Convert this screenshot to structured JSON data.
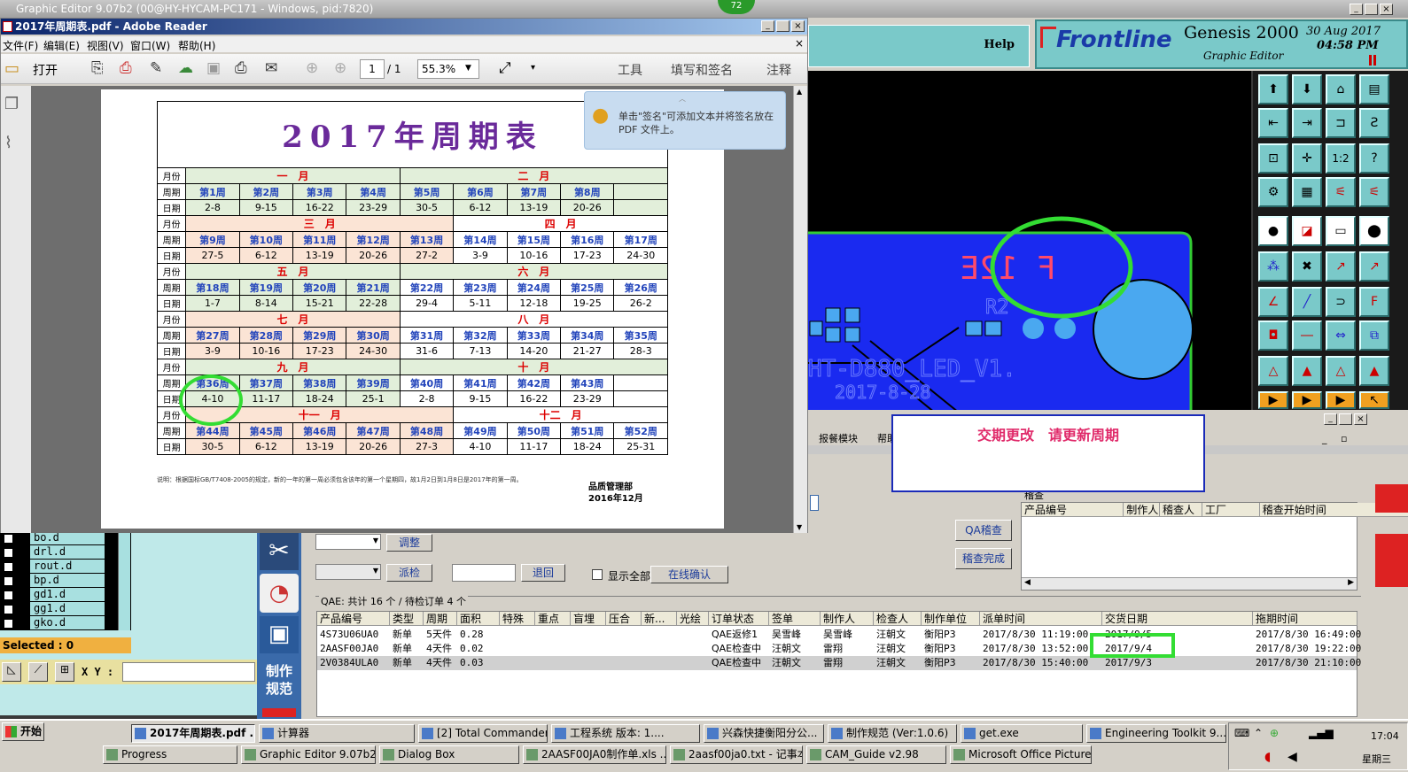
{
  "genesis": {
    "window_title": "Graphic Editor 9.07b2 (00@HY-HYCAM-PC171 - Windows, pid:7820)",
    "help_label": "Help",
    "brand": "Frontline",
    "product": "Genesis 2000",
    "subtitle": "Graphic Editor",
    "date": "30 Aug 2017",
    "time": "04:58 PM",
    "badge": "72",
    "selected": "Selected : 0",
    "xy_label": "X Y :",
    "layers": [
      "bo.d",
      "drl.d",
      "rout.d",
      "bp.d",
      "gd1.d",
      "gg1.d",
      "gko.d"
    ],
    "pcb_texts": {
      "mark": "F 12E",
      "r2": "R2",
      "part": "HT-D880_LED_V1.",
      "date": "2017-8-28"
    }
  },
  "pdf": {
    "title": "2017年周期表.pdf - Adobe Reader",
    "menu": [
      "文件(F)",
      "编辑(E)",
      "视图(V)",
      "窗口(W)",
      "帮助(H)"
    ],
    "open_label": "打开",
    "page_current": "1",
    "page_total": "/ 1",
    "zoom": "55.3%",
    "right_tools": [
      "工具",
      "填写和签名",
      "注释"
    ],
    "tip": "单击\"签名\"可添加文本并将签名放在 PDF 文件上。",
    "calendar_title": "2017年周期表",
    "label_month": "月份",
    "label_week": "周期",
    "label_date": "日期",
    "rows": [
      {
        "months": [
          "一　月",
          "二　月"
        ],
        "split": 4,
        "weeks": [
          "第1周",
          "第2周",
          "第3周",
          "第4周",
          "第5周",
          "第6周",
          "第7周",
          "第8周",
          ""
        ],
        "dates": [
          "2-8",
          "9-15",
          "16-22",
          "23-29",
          "30-5",
          "6-12",
          "13-19",
          "20-26",
          ""
        ]
      },
      {
        "months": [
          "三　月",
          "四　月"
        ],
        "split": 5,
        "weeks": [
          "第9周",
          "第10周",
          "第11周",
          "第12周",
          "第13周",
          "第14周",
          "第15周",
          "第16周",
          "第17周"
        ],
        "dates": [
          "27-5",
          "6-12",
          "13-19",
          "20-26",
          "27-2",
          "3-9",
          "10-16",
          "17-23",
          "24-30"
        ]
      },
      {
        "months": [
          "五　月",
          "六　月"
        ],
        "split": 4,
        "weeks": [
          "第18周",
          "第19周",
          "第20周",
          "第21周",
          "第22周",
          "第23周",
          "第24周",
          "第25周",
          "第26周"
        ],
        "dates": [
          "1-7",
          "8-14",
          "15-21",
          "22-28",
          "29-4",
          "5-11",
          "12-18",
          "19-25",
          "26-2"
        ]
      },
      {
        "months": [
          "七　月",
          "八　月"
        ],
        "split": 4,
        "weeks": [
          "第27周",
          "第28周",
          "第29周",
          "第30周",
          "第31周",
          "第32周",
          "第33周",
          "第34周",
          "第35周"
        ],
        "dates": [
          "3-9",
          "10-16",
          "17-23",
          "24-30",
          "31-6",
          "7-13",
          "14-20",
          "21-27",
          "28-3"
        ]
      },
      {
        "months": [
          "九　月",
          "十　月"
        ],
        "split": 4,
        "weeks": [
          "第36周",
          "第37周",
          "第38周",
          "第39周",
          "第40周",
          "第41周",
          "第42周",
          "第43周",
          ""
        ],
        "dates": [
          "4-10",
          "11-17",
          "18-24",
          "25-1",
          "2-8",
          "9-15",
          "16-22",
          "23-29",
          ""
        ]
      },
      {
        "months": [
          "十一　月",
          "十二　月"
        ],
        "split": 5,
        "weeks": [
          "第44周",
          "第45周",
          "第46周",
          "第47周",
          "第48周",
          "第49周",
          "第50周",
          "第51周",
          "第52周"
        ],
        "dates": [
          "30-5",
          "6-12",
          "13-19",
          "20-26",
          "27-3",
          "4-10",
          "11-17",
          "18-24",
          "25-31"
        ]
      }
    ],
    "note": "说明：根据国标GB/T7408-2005的规定，新的一年的第一周必须包含该年的第一个星期四，故1月2日到1月8日是2017年的第一周。",
    "dept": "品质管理部",
    "doc_date": "2016年12月"
  },
  "dialog": {
    "notice": "交期更改　请更新周期",
    "menu_items": [
      "报餐模块",
      "帮助"
    ],
    "buttons": {
      "adjust": "调整",
      "dispatch": "派检",
      "return": "退回",
      "online_confirm": "在线确认",
      "qa_audit": "QA稽查",
      "audit_done": "稽查完成"
    },
    "show_all": "显示全部",
    "audit_group": "稽查",
    "audit_cols": [
      "产品编号",
      "制作人",
      "稽查人",
      "工厂",
      "稽查开始时间"
    ],
    "qa_summary": "QAE: 共计 16 个 / 待检订单 4 个",
    "side_label": "制作规范",
    "columns": [
      "产品编号",
      "类型",
      "周期",
      "面积",
      "特殊",
      "重点",
      "盲埋",
      "压合",
      "新...",
      "光绘",
      "订单状态",
      "签单",
      "制作人",
      "检查人",
      "制作单位",
      "派单时间",
      "交货日期",
      "拖期时间"
    ],
    "rows": [
      [
        "4S73U06UA0",
        "新单",
        "5天件",
        "0.28",
        "",
        "",
        "",
        "",
        "",
        "",
        "QAE返修1",
        "吴雪峰",
        "吴雪峰",
        "汪朝文",
        "衡阳P3",
        "2017/8/30 11:19:00",
        "2017/9/5",
        "2017/8/30 16:49:00"
      ],
      [
        "2AASF00JA0",
        "新单",
        "4天件",
        "0.02",
        "",
        "",
        "",
        "",
        "",
        "",
        "QAE检查中",
        "汪朝文",
        "雷翔",
        "汪朝文",
        "衡阳P3",
        "2017/8/30 13:52:00",
        "2017/9/4",
        "2017/8/30 19:22:00"
      ],
      [
        "2V0384ULA0",
        "新单",
        "4天件",
        "0.03",
        "",
        "",
        "",
        "",
        "",
        "",
        "QAE检查中",
        "汪朝文",
        "雷翔",
        "汪朝文",
        "衡阳P3",
        "2017/8/30 15:40:00",
        "2017/9/3",
        "2017/8/30 21:10:00"
      ]
    ]
  },
  "taskbar": {
    "start": "开始",
    "row1": [
      "2017年周期表.pdf ...",
      "计算器",
      "[2] Total Commander ...",
      "工程系统 版本: 1....",
      "兴森快捷衡阳分公...",
      "制作规范 (Ver:1.0.6)",
      "get.exe",
      "Engineering Toolkit 9...."
    ],
    "row2": [
      "Progress",
      "Graphic Editor 9.07b2 (0...",
      "Dialog Box",
      "2AASF00JA0制作单.xls ...",
      "2aasf00ja0.txt - 记事本",
      "CAM_Guide v2.98",
      "Microsoft Office Picture ..."
    ],
    "clock": "17:04",
    "weekday": "星期三"
  }
}
